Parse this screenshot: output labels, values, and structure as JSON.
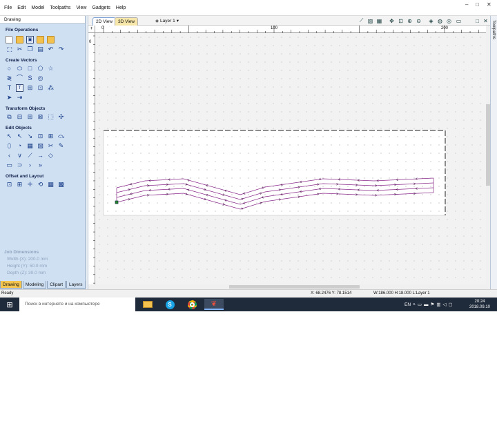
{
  "menu": [
    "File",
    "Edit",
    "Model",
    "Toolpaths",
    "View",
    "Gadgets",
    "Help"
  ],
  "window_controls": [
    "–",
    "□",
    "✕"
  ],
  "panel": {
    "title": "Drawing",
    "sections": [
      {
        "title": "File Operations",
        "icons": [
          "new-file-icon",
          "open-folder-icon",
          "save-icon",
          "folder-icon",
          "import-icon",
          "select-all-icon",
          "cut-icon",
          "copy-icon",
          "paste-icon",
          "undo-icon",
          "redo-icon"
        ]
      },
      {
        "title": "Create Vectors",
        "icons": [
          "circle-icon",
          "ellipse-icon",
          "rectangle-icon",
          "polygon-icon",
          "star-icon",
          "polyline-icon",
          "arc-icon",
          "spiral-icon",
          "fillet-icon",
          "text-icon",
          "text-on-curve-icon",
          "dimension-icon",
          "trace-icon",
          "node-icon"
        ]
      },
      {
        "title": "Transform Objects",
        "icons": [
          "move-icon",
          "align-icon",
          "mirror-icon",
          "scale-icon",
          "distort-icon"
        ]
      },
      {
        "title": "Edit Objects",
        "icons": [
          "select-icon",
          "node-edit-icon",
          "transform-icon",
          "group-icon",
          "ungroup-icon",
          "weld-icon",
          "subtract-icon",
          "intersect-icon",
          "trim-icon",
          "extend-icon",
          "join-icon",
          "close-icon",
          "smooth-icon",
          "fillet-edit-icon",
          "offset-icon"
        ]
      },
      {
        "title": "Offset and Layout",
        "icons": [
          "offset-layout-icon",
          "array-icon",
          "nest-icon",
          "circular-array-icon",
          "tile-icon"
        ]
      }
    ],
    "job_dimensions": {
      "title": "Job Dimensions",
      "width": "Width  (X): 200.0 mm",
      "height": "Height (Y): 50.0 mm",
      "depth": "Depth  (Z): 30.0 mm"
    },
    "bottom_tabs": [
      "Drawing",
      "Modeling",
      "Clipart",
      "Layers"
    ]
  },
  "doc_tabs": [
    "2D View",
    "3D View"
  ],
  "layer": "Layer 1",
  "ruler": {
    "h_labels": [
      "0",
      "100",
      "200"
    ],
    "v_labels": [
      "0"
    ]
  },
  "side_dock_label": "Toolpaths",
  "status": {
    "ready": "Ready",
    "coords": "X: 68.2476 Y: 78.1514",
    "size": "W:186.000  H:18.000  L:Layer 1"
  },
  "taskbar": {
    "search": "Поиск в интернете и на компьютере",
    "lang": "EN",
    "time": "20:24",
    "date": "2018.09.10"
  },
  "colors": {
    "path": "#8a2a8a",
    "job_border": "#222222",
    "panel": "#cfe0f3",
    "active_tab": "#f4c54f"
  }
}
